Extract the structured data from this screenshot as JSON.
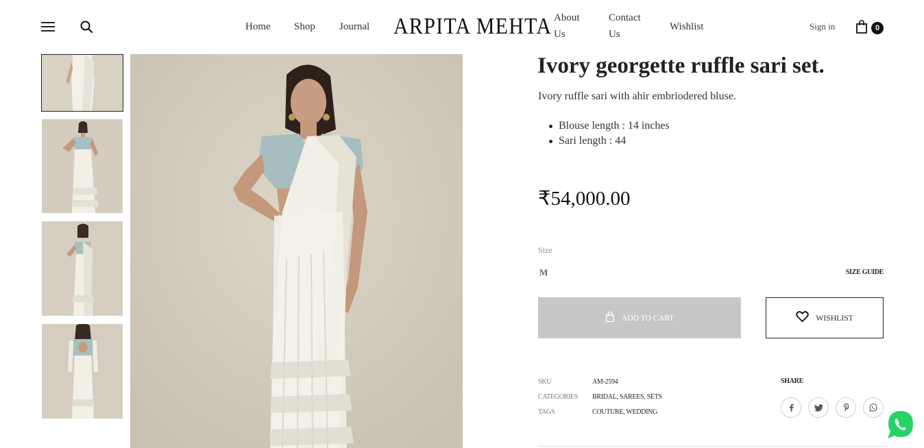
{
  "header": {
    "nav_left": [
      "Home",
      "Shop",
      "Journal"
    ],
    "logo": "ARPITA MEHTA",
    "nav_right": [
      "About Us",
      "Contact Us",
      "Wishlist"
    ],
    "signin": "Sign in",
    "cart_count": "0",
    "icons": [
      "menu-icon",
      "search-icon",
      "shopping-bag-icon"
    ]
  },
  "gallery": {
    "thumbnails": [
      "thumbnail-front",
      "thumbnail-side-pose",
      "thumbnail-side-standing",
      "thumbnail-back"
    ],
    "active_index": 0
  },
  "product": {
    "title": "Ivory georgette ruffle sari set.",
    "description": "Ivory ruffle sari with ahir embriodered bluse.",
    "details": [
      "Blouse length : 14 inches",
      "Sari length : 44"
    ],
    "price": "₹54,000.00",
    "size_label": "Size",
    "size_selected": "M",
    "size_guide": "SIZE GUIDE",
    "add_to_cart": "ADD TO CART",
    "wishlist": "WISHLIST",
    "meta": {
      "sku_label": "SKU",
      "sku": "AM-2594",
      "categories_label": "CATEGORIES",
      "categories": "BRIDAL, SAREES, SETS",
      "tags_label": "TAGS",
      "tags": "COUTURE, WEDDING"
    },
    "share_label": "SHARE",
    "share_icons": [
      "facebook-icon",
      "twitter-icon",
      "pinterest-icon",
      "whatsapp-icon"
    ]
  },
  "colors": {
    "add_to_cart_disabled": "#c6c7c9",
    "text_dark": "#222222",
    "whatsapp_green": "#25d366",
    "photo_backdrop": "#d6d0c2",
    "sari_ivory": "#f1efe6",
    "blouse_blue": "#a9c2c4"
  }
}
